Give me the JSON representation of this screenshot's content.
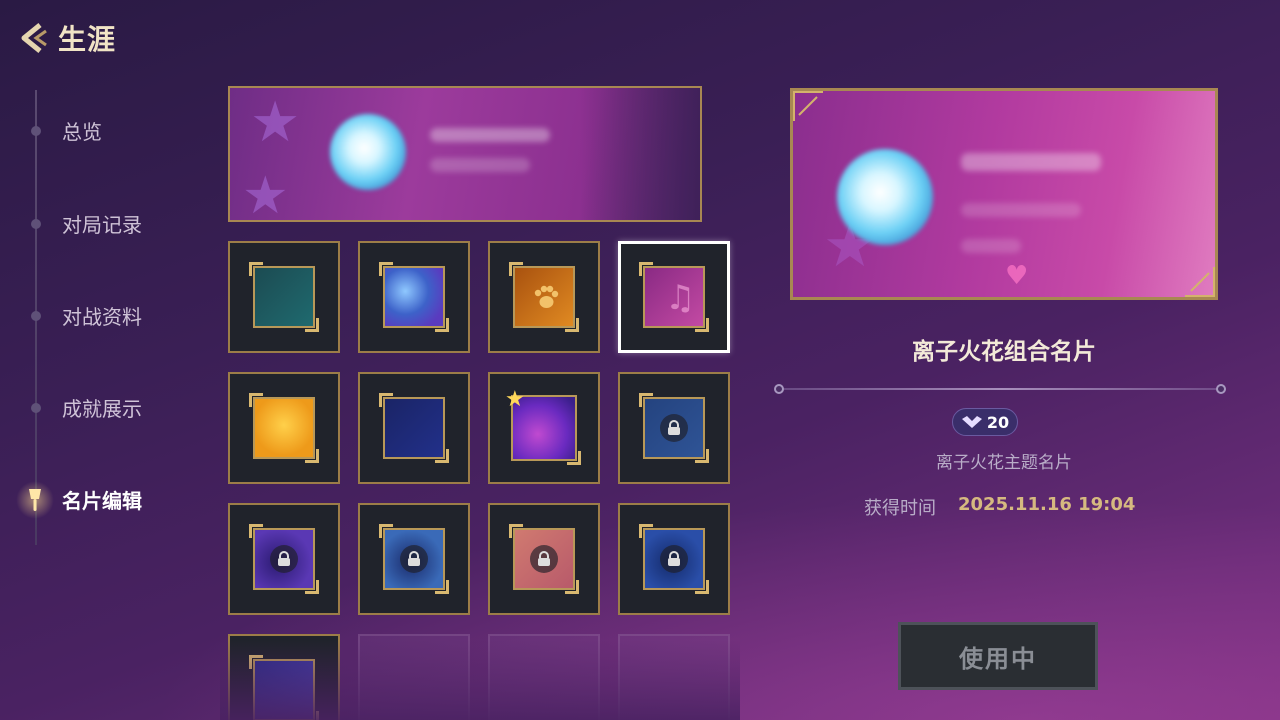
{
  "header": {
    "title": "生涯",
    "back_icon": "chevron-left-icon"
  },
  "sidebar": {
    "items": [
      {
        "label": "总览",
        "active": false
      },
      {
        "label": "对局记录",
        "active": false
      },
      {
        "label": "对战资料",
        "active": false
      },
      {
        "label": "成就展示",
        "active": false
      },
      {
        "label": "名片编辑",
        "active": true,
        "icon": "brush-icon"
      }
    ]
  },
  "grid": {
    "tiles": [
      {
        "name": "teal-card",
        "locked": false,
        "selected": false,
        "color": "#1f5b63"
      },
      {
        "name": "starry-blue-card",
        "locked": false,
        "selected": false,
        "color": "#3d62c9"
      },
      {
        "name": "paw-orange-card",
        "locked": false,
        "selected": false,
        "color": "#c9721a"
      },
      {
        "name": "music-pink-card",
        "locked": false,
        "selected": true,
        "color": "#b03f97"
      },
      {
        "name": "sun-yellow-card",
        "locked": false,
        "selected": false,
        "color": "#eea21c"
      },
      {
        "name": "navy-card",
        "locked": false,
        "selected": false,
        "color": "#1f2a72"
      },
      {
        "name": "comet-purple-card",
        "locked": false,
        "selected": false,
        "color": "#6a2ac0"
      },
      {
        "name": "locked-blue-card",
        "locked": true,
        "selected": false,
        "color": "#2a4a8c"
      },
      {
        "name": "locked-violet-card",
        "locked": true,
        "selected": false,
        "color": "#4a2e9a"
      },
      {
        "name": "locked-ocean-card",
        "locked": true,
        "selected": false,
        "color": "#2f5aa0"
      },
      {
        "name": "locked-coral-card",
        "locked": true,
        "selected": false,
        "color": "#c86a6a"
      },
      {
        "name": "locked-deepblue-card",
        "locked": true,
        "selected": false,
        "color": "#1e3c8a"
      },
      {
        "name": "locked-indigo-card",
        "locked": true,
        "selected": false,
        "color": "#3a3aa0"
      }
    ],
    "empty_slots": 3
  },
  "detail": {
    "title": "离子火花组合名片",
    "price": "20",
    "price_icon": "gem-currency-icon",
    "subtitle": "离子火花主题名片",
    "obtain_label": "获得时间",
    "obtain_time": "2025.11.16  19:04",
    "button_label": "使用中"
  },
  "colors": {
    "accent_gold": "#a88852",
    "text_gold": "#d6b980",
    "bg_purple": "#3a1f55"
  }
}
